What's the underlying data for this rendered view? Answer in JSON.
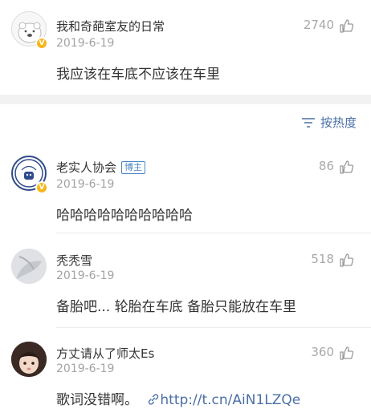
{
  "top_comment": {
    "username": "我和奇葩室友的日常",
    "date": "2019-6-19",
    "likes": "2740",
    "text": "我应该在车底不应该在车里"
  },
  "sort": {
    "label": "按热度"
  },
  "replies": [
    {
      "username": "老实人协会",
      "tag": "博主",
      "date": "2019-6-19",
      "likes": "86",
      "text": "哈哈哈哈哈哈哈哈哈哈"
    },
    {
      "username": "秃秃雪",
      "date": "2019-6-19",
      "likes": "518",
      "text": "备胎吧... 轮胎在车底 备胎只能放在车里"
    },
    {
      "username": "方丈请从了师太Es",
      "date": "2019-6-19",
      "likes": "360",
      "text_prefix": "歌词没错啊。",
      "link": "http://t.cn/AiN1LZQe"
    }
  ],
  "icons": {
    "like": "thumb-up-icon",
    "verified": "verified-badge-icon",
    "sort": "sort-lines-icon",
    "link": "link-icon"
  },
  "colors": {
    "accent_link": "#4a6fa5",
    "verified_badge": "#f5b61a",
    "tag_blue": "#4a86c6",
    "muted": "#a3a3a3"
  }
}
